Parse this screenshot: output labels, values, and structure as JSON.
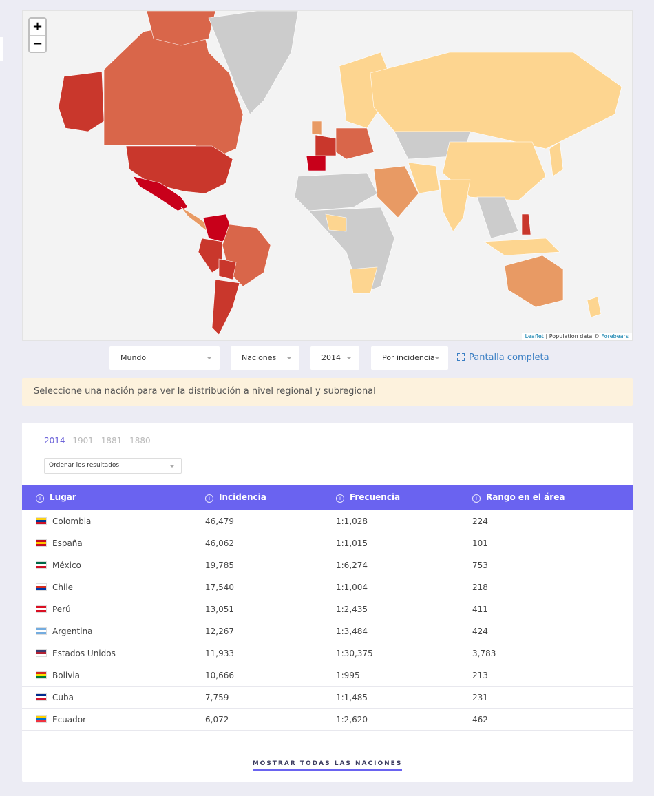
{
  "map": {
    "zoom_in_label": "+",
    "zoom_out_label": "−",
    "attribution": {
      "leaflet": "Leaflet",
      "text": " | Population data © ",
      "source": "Forebears"
    }
  },
  "controls": {
    "region": "Mundo",
    "level": "Naciones",
    "year": "2014",
    "mode": "Por incidencia",
    "fullscreen": "Pantalla completa"
  },
  "notice": "Seleccione una nación para ver la distribución a nivel regional y subregional",
  "results": {
    "years": [
      "2014",
      "1901",
      "1881",
      "1880"
    ],
    "active_year": "2014",
    "sort_placeholder": "Ordenar los resultados",
    "info_glyph": "i",
    "columns": [
      "Lugar",
      "Incidencia",
      "Frecuencia",
      "Rango en el área"
    ],
    "rows": [
      {
        "place": "Colombia",
        "incidence": "46,479",
        "frequency": "1:1,028",
        "rank": "224",
        "flag": [
          "#fcd116",
          "#003893",
          "#ce1126"
        ]
      },
      {
        "place": "España",
        "incidence": "46,062",
        "frequency": "1:1,015",
        "rank": "101",
        "flag": [
          "#c60b1e",
          "#ffc400",
          "#c60b1e"
        ]
      },
      {
        "place": "México",
        "incidence": "19,785",
        "frequency": "1:6,274",
        "rank": "753",
        "flag": [
          "#006847",
          "#ffffff",
          "#ce1126"
        ]
      },
      {
        "place": "Chile",
        "incidence": "17,540",
        "frequency": "1:1,004",
        "rank": "218",
        "flag": [
          "#ffffff",
          "#d52b1e",
          "#0039a6"
        ]
      },
      {
        "place": "Perú",
        "incidence": "13,051",
        "frequency": "1:2,435",
        "rank": "411",
        "flag": [
          "#d91023",
          "#ffffff",
          "#d91023"
        ]
      },
      {
        "place": "Argentina",
        "incidence": "12,267",
        "frequency": "1:3,484",
        "rank": "424",
        "flag": [
          "#74acdf",
          "#ffffff",
          "#74acdf"
        ]
      },
      {
        "place": "Estados Unidos",
        "incidence": "11,933",
        "frequency": "1:30,375",
        "rank": "3,783",
        "flag": [
          "#3c3b6e",
          "#b22234",
          "#ffffff"
        ]
      },
      {
        "place": "Bolivia",
        "incidence": "10,666",
        "frequency": "1:995",
        "rank": "213",
        "flag": [
          "#d52b1e",
          "#f9e300",
          "#007934"
        ]
      },
      {
        "place": "Cuba",
        "incidence": "7,759",
        "frequency": "1:1,485",
        "rank": "231",
        "flag": [
          "#002a8f",
          "#ffffff",
          "#cf142b"
        ]
      },
      {
        "place": "Ecuador",
        "incidence": "6,072",
        "frequency": "1:2,620",
        "rank": "462",
        "flag": [
          "#ffd100",
          "#0072ce",
          "#ef3340"
        ]
      }
    ],
    "show_all": "MOSTRAR TODAS LAS NACIONES"
  },
  "colors": {
    "accent": "#6a63f0",
    "link": "#3b7fc4",
    "notice_bg": "#fdf2dd",
    "map_scale": [
      "#c8001a",
      "#c9372c",
      "#d9664a",
      "#e89a64",
      "#fdd590",
      "#cccccc"
    ]
  }
}
